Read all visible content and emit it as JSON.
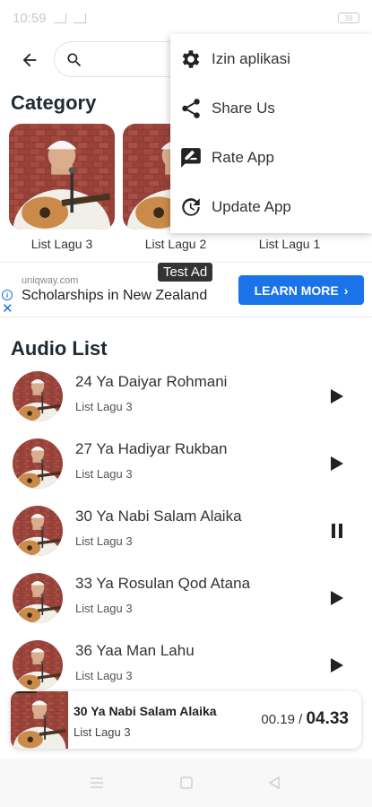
{
  "status_bar": {
    "time": "10:59",
    "battery": "39"
  },
  "toolbar": {
    "search_placeholder": ""
  },
  "category": {
    "title": "Category",
    "items": [
      {
        "label": "List Lagu 3"
      },
      {
        "label": "List Lagu 2"
      },
      {
        "label": "List Lagu 1"
      }
    ]
  },
  "ad": {
    "badge": "Test Ad",
    "domain": "uniqway.com",
    "title": "Scholarships in New Zealand",
    "cta": "LEARN MORE"
  },
  "audio": {
    "title": "Audio List",
    "items": [
      {
        "title": "24 Ya Daiyar Rohmani",
        "subtitle": "List Lagu 3",
        "state": "play"
      },
      {
        "title": "27 Ya Hadiyar Rukban",
        "subtitle": "List Lagu 3",
        "state": "play"
      },
      {
        "title": "30 Ya Nabi Salam Alaika",
        "subtitle": "List Lagu 3",
        "state": "pause"
      },
      {
        "title": "33 Ya Rosulan Qod Atana",
        "subtitle": "List Lagu 3",
        "state": "play"
      },
      {
        "title": "36 Yaa Man Lahu",
        "subtitle": "List Lagu 3",
        "state": "play"
      }
    ]
  },
  "player": {
    "title": "30 Ya Nabi Salam Alaika",
    "subtitle": "List Lagu 3",
    "current_time": "00.19",
    "separator": "/",
    "total_time": "04.33",
    "progress": 0.073
  },
  "menu": {
    "items": [
      {
        "label": "Izin aplikasi",
        "icon": "gear-icon"
      },
      {
        "label": "Share Us",
        "icon": "share-icon"
      },
      {
        "label": "Rate App",
        "icon": "rate-icon"
      },
      {
        "label": "Update App",
        "icon": "update-icon"
      }
    ]
  },
  "colors": {
    "accent": "#1a73e8",
    "text": "#222222",
    "brick": "#8e3b33"
  }
}
